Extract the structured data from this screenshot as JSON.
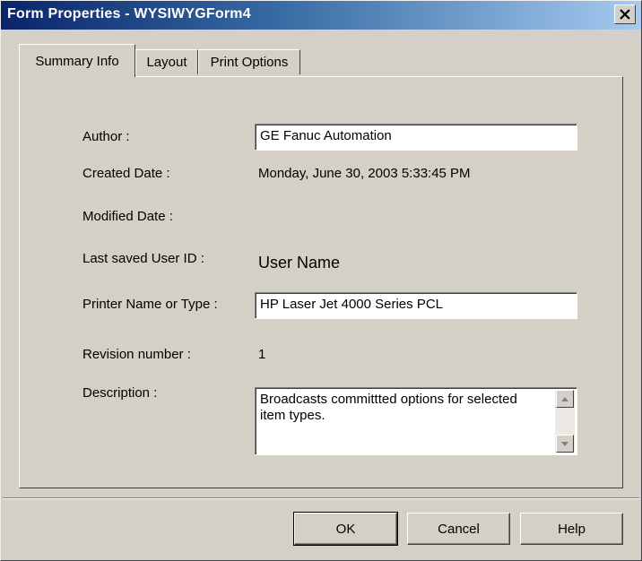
{
  "window": {
    "title": "Form Properties - WYSIWYGForm4"
  },
  "tabs": [
    {
      "label": "Summary Info",
      "active": true
    },
    {
      "label": "Layout",
      "active": false
    },
    {
      "label": "Print Options",
      "active": false
    }
  ],
  "summary": {
    "author_label": "Author :",
    "author_value": "GE Fanuc Automation",
    "created_label": "Created Date :",
    "created_value": "Monday, June 30, 2003 5:33:45 PM",
    "modified_label": "Modified Date :",
    "modified_value": "",
    "last_saved_label": "Last saved User ID :",
    "last_saved_value": "User Name",
    "printer_label": "Printer Name or Type :",
    "printer_value": "HP Laser Jet 4000 Series PCL",
    "revision_label": "Revision number :",
    "revision_value": "1",
    "description_label": "Description :",
    "description_value": "Broadcasts committted options for selected item types."
  },
  "buttons": {
    "ok": "OK",
    "cancel": "Cancel",
    "help": "Help"
  },
  "icons": {
    "close": "close-icon",
    "scroll_up": "arrow-up-icon",
    "scroll_down": "arrow-down-icon"
  }
}
